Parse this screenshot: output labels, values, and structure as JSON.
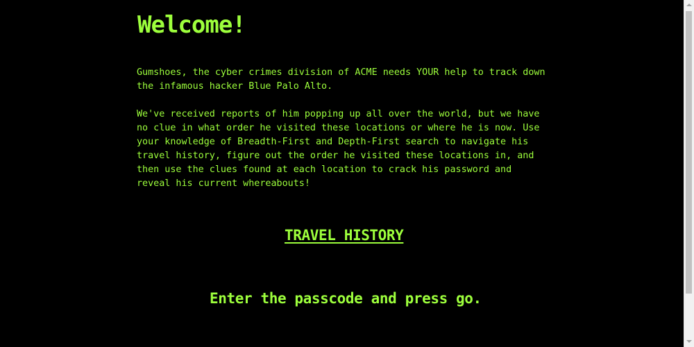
{
  "page": {
    "title": "Welcome!",
    "intro": "Gumshoes, the cyber crimes division of ACME needs YOUR help to track down\nthe infamous hacker Blue Palo Alto.",
    "instructions": "We've received reports of him popping up all over the world, but we have\nno clue in what order he visited these locations or where he is now. Use\nyour knowledge of Breadth-First and Depth-First search to navigate his\ntravel history, figure out the order he visited these locations in, and\nthen use the clues found at each location to crack his password and\nreveal his current whereabouts!",
    "travel_link_label": "TRAVEL HISTORY",
    "passcode_prompt": "Enter the passcode and press go."
  },
  "colors": {
    "background": "#000000",
    "text": "#9dff3c"
  }
}
